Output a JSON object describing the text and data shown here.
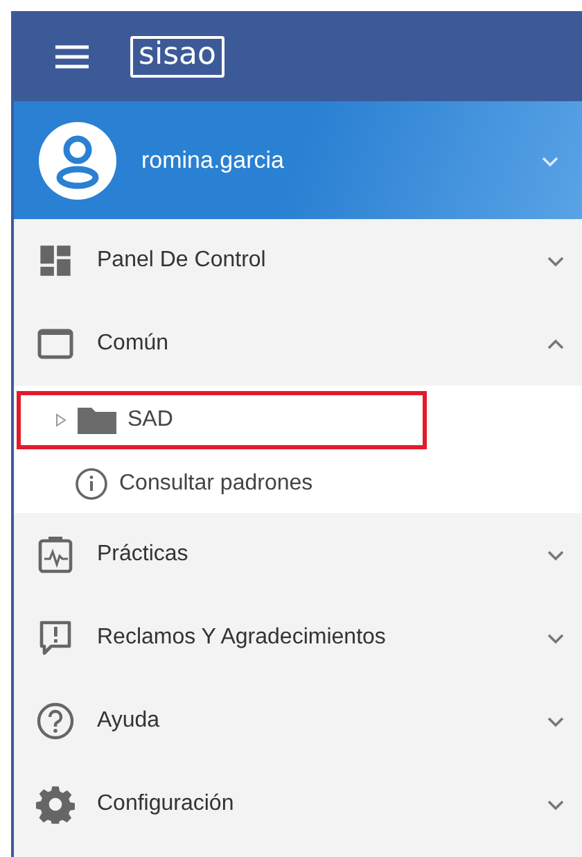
{
  "header": {
    "logo": "sisao"
  },
  "user": {
    "name": "romina.garcia",
    "expanded": false
  },
  "menu": [
    {
      "label": "Panel De Control",
      "kind": "dashboard",
      "expanded": false
    },
    {
      "label": "Común",
      "kind": "window",
      "expanded": true,
      "children": [
        {
          "label": "SAD",
          "kind": "folder",
          "expanded": false,
          "highlighted": true
        },
        {
          "label": "Consultar padrones",
          "kind": "info",
          "highlighted": false
        }
      ]
    },
    {
      "label": "Prácticas",
      "kind": "clipboard",
      "expanded": false
    },
    {
      "label": "Reclamos Y Agradecimientos",
      "kind": "feedback",
      "expanded": false
    },
    {
      "label": "Ayuda",
      "kind": "help",
      "expanded": false
    },
    {
      "label": "Configuración",
      "kind": "settings",
      "expanded": false
    }
  ]
}
